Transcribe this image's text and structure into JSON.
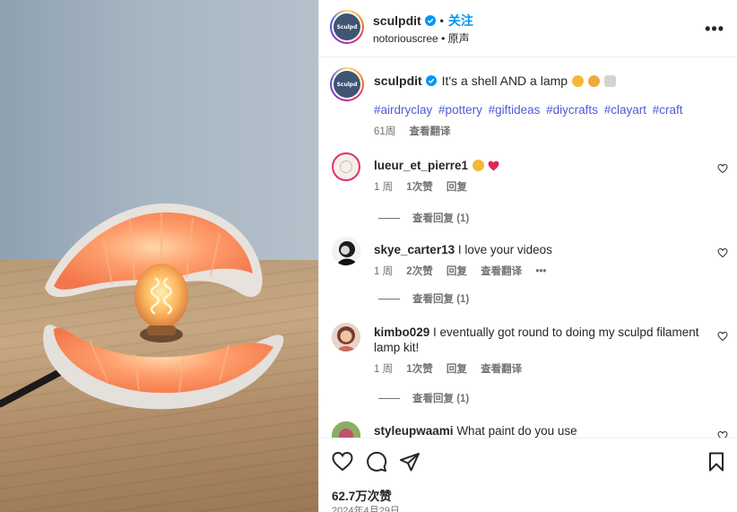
{
  "post": {
    "username": "sculpdit",
    "follow_label": "关注",
    "subtitle_user": "notoriouscree",
    "subtitle_extra": "原声",
    "more_label": "•••",
    "avatar_text": "Sculpd"
  },
  "caption": {
    "username": "sculpdit",
    "text": "It's a shell AND a lamp",
    "hashtags": [
      "#airdryclay",
      "#pottery",
      "#giftideas",
      "#diycrafts",
      "#clayart",
      "#craft"
    ],
    "time": "61周",
    "translate": "查看翻译"
  },
  "comments": [
    {
      "username": "lueur_et_pierre1",
      "text": "",
      "time": "1 周",
      "likes": "1次赞",
      "reply": "回复",
      "replies": "查看回复 (1)"
    },
    {
      "username": "skye_carter13",
      "text": "I love your videos",
      "time": "1 周",
      "likes": "2次赞",
      "reply": "回复",
      "translate": "查看翻译",
      "more": "•••",
      "replies": "查看回复 (1)"
    },
    {
      "username": "kimbo029",
      "text": "I eventually got round to doing my sculpd filament lamp kit!",
      "time": "1 周",
      "likes": "1次赞",
      "reply": "回复",
      "translate": "查看翻译",
      "replies": "查看回复 (1)"
    },
    {
      "username": "styleupwaami",
      "text": "What paint do you use"
    }
  ],
  "footer": {
    "likes": "62.7万次赞",
    "date": "2024年4月29日"
  },
  "colors": {
    "accent": "#0095f6",
    "hashtag": "#4f5bd5",
    "muted": "#737373"
  }
}
